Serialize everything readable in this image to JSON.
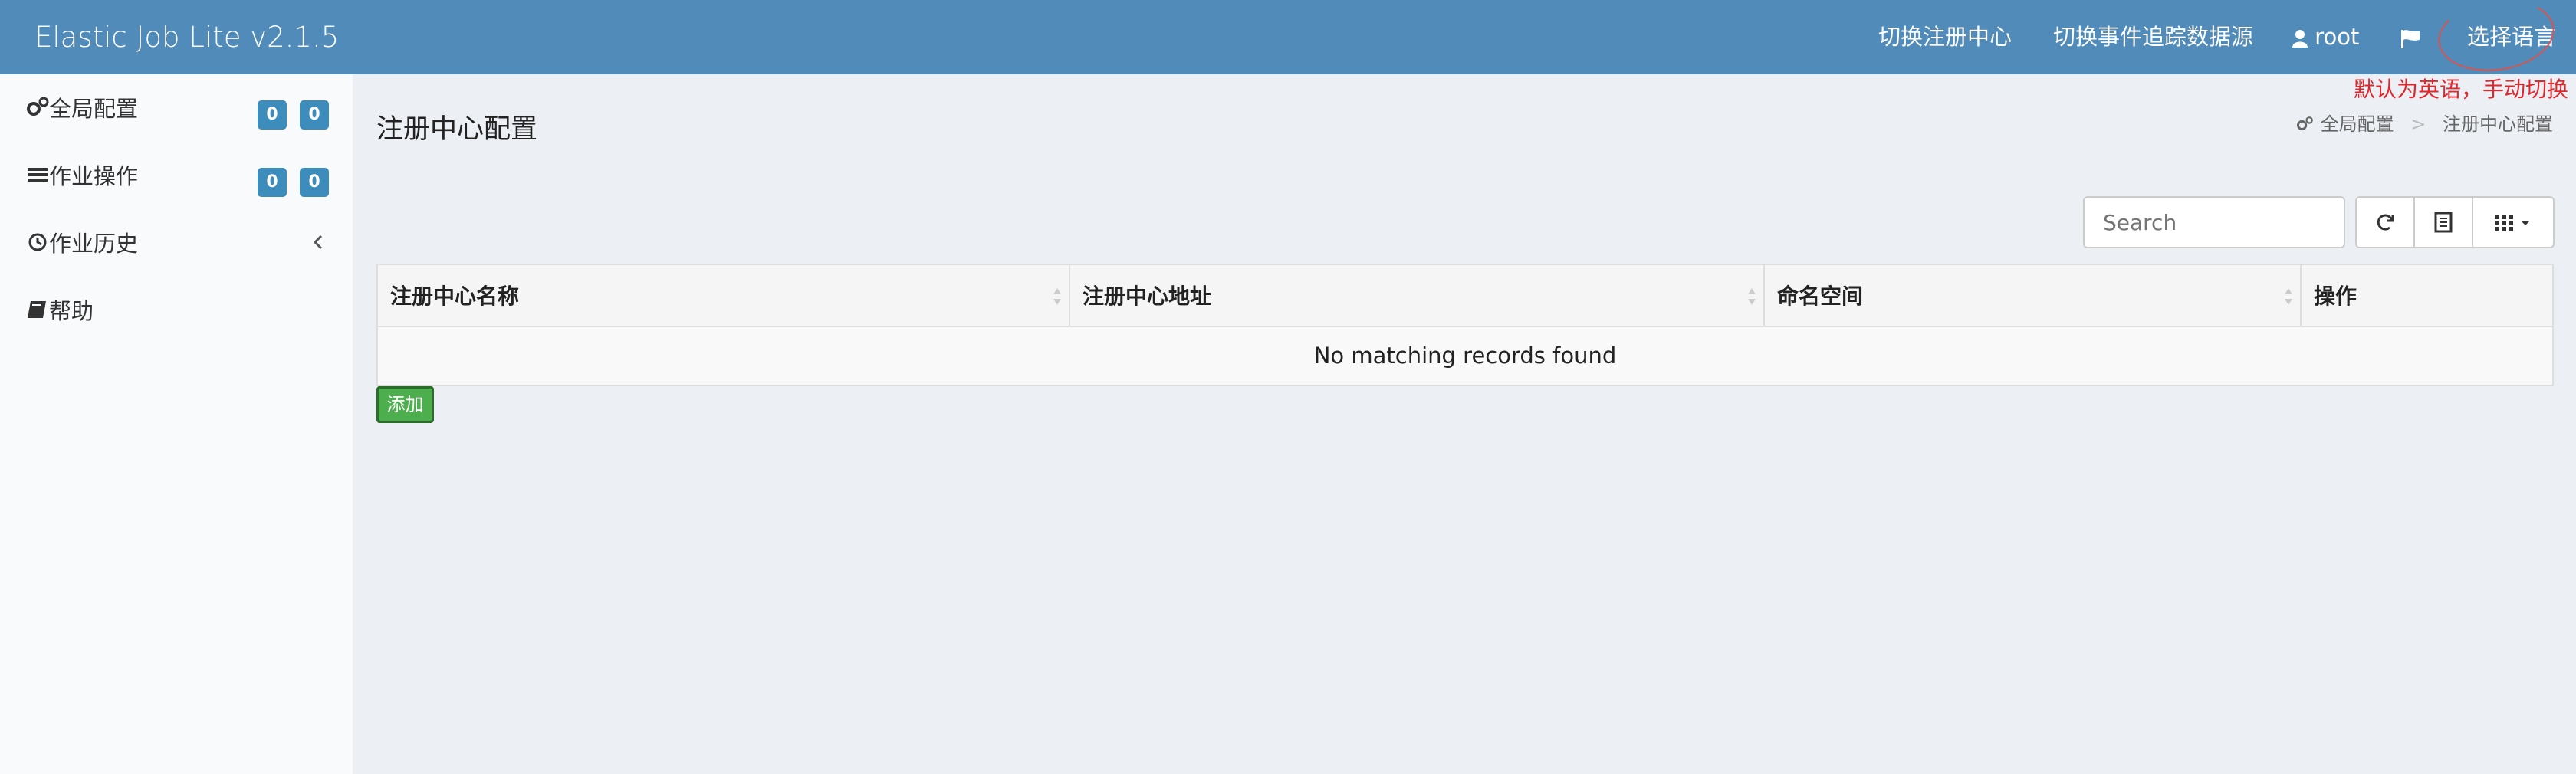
{
  "header": {
    "brand": "Elastic Job Lite v2.1.5",
    "nav": {
      "switch_registry": "切换注册中心",
      "switch_datasource": "切换事件追踪数据源",
      "user": "root",
      "language": "选择语言"
    },
    "annotation": "默认为英语，手动切换",
    "accent_color": "#508bba"
  },
  "sidebar": {
    "items": [
      {
        "label": "全局配置",
        "icon": "gears-icon",
        "badges": [
          "0",
          "0"
        ]
      },
      {
        "label": "作业操作",
        "icon": "tasks-icon",
        "badges": [
          "0",
          "0"
        ]
      },
      {
        "label": "作业历史",
        "icon": "history-icon",
        "has_chevron": true
      },
      {
        "label": "帮助",
        "icon": "book-icon"
      }
    ]
  },
  "main": {
    "title": "注册中心配置",
    "breadcrumb": {
      "parent": "全局配置",
      "current": "注册中心配置",
      "separator": ">"
    },
    "search_placeholder": "Search",
    "table": {
      "columns": [
        "注册中心名称",
        "注册中心地址",
        "命名空间",
        "操作"
      ],
      "empty_message": "No matching records found"
    },
    "add_button": "添加"
  }
}
